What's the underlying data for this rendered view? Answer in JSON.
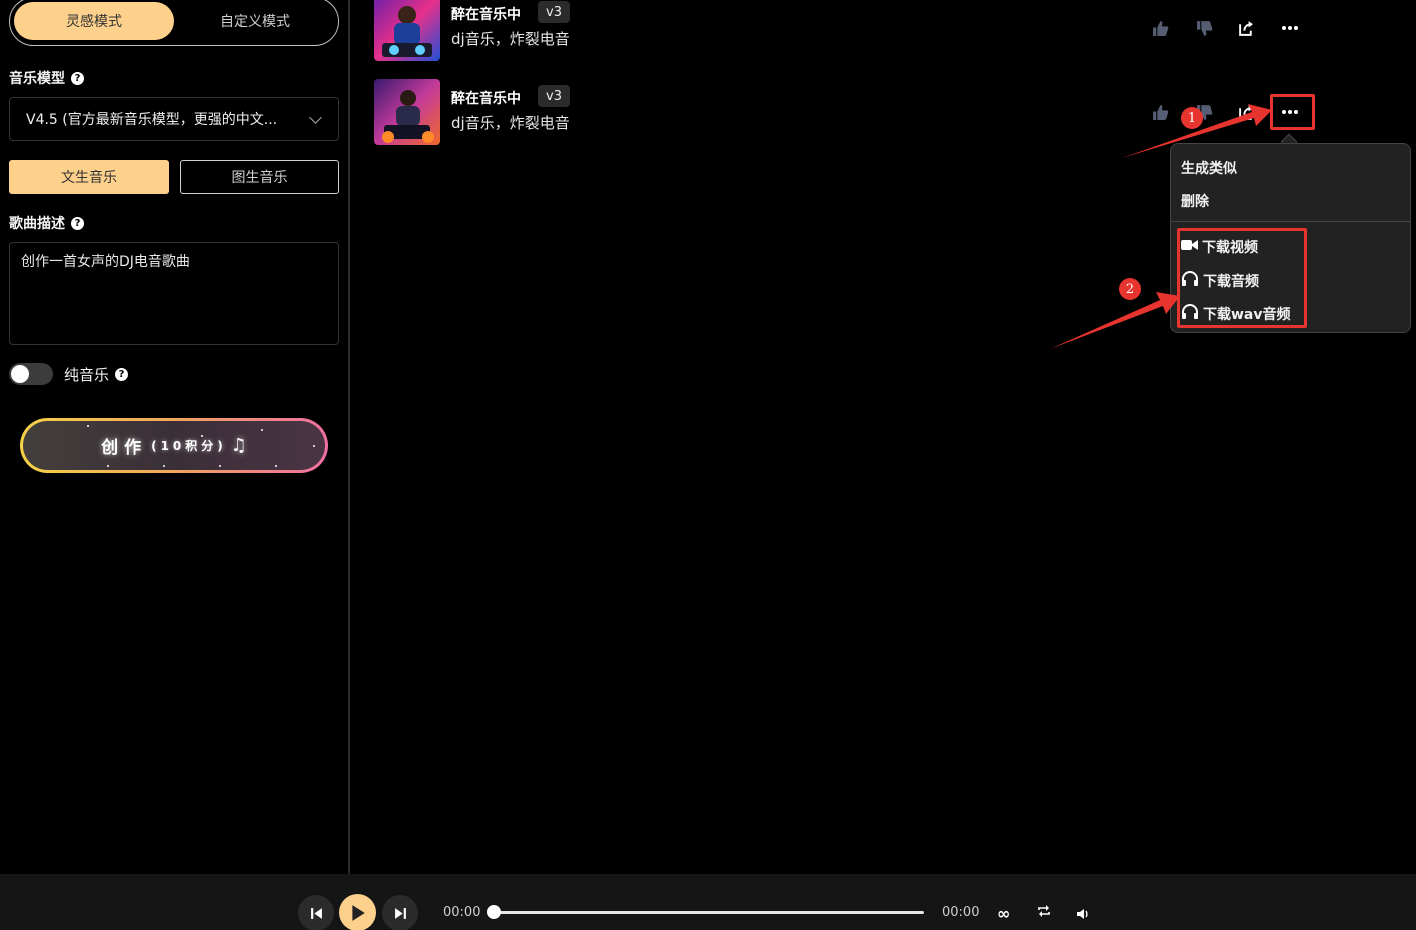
{
  "sidebar": {
    "modes": {
      "inspiration": "灵感模式",
      "custom": "自定义模式"
    },
    "model_label": "音乐模型",
    "model_value": "V4.5 (官方最新音乐模型，更强的中文...",
    "gen_types": {
      "text": "文生音乐",
      "image": "图生音乐"
    },
    "desc_label": "歌曲描述",
    "desc_value": "创作一首女声的DJ电音歌曲",
    "instrumental_label": "纯音乐",
    "create_main": "创作",
    "create_sub": "(10积分)"
  },
  "songs": [
    {
      "title": "醉在音乐中",
      "version": "v3",
      "tags": "dj音乐，炸裂电音"
    },
    {
      "title": "醉在音乐中",
      "version": "v3",
      "tags": "dj音乐，炸裂电音"
    }
  ],
  "menu": {
    "items": [
      "生成类似",
      "删除"
    ],
    "download": [
      "下载视频",
      "下载音频",
      "下载wav音频"
    ]
  },
  "annotations": {
    "step1": "1",
    "step2": "2"
  },
  "player": {
    "current_time": "00:00",
    "total_time": "00:00",
    "progress": 0
  },
  "colors": {
    "accent": "#fdd18c",
    "annotation": "#e8342f",
    "menu_bg": "#222222"
  }
}
